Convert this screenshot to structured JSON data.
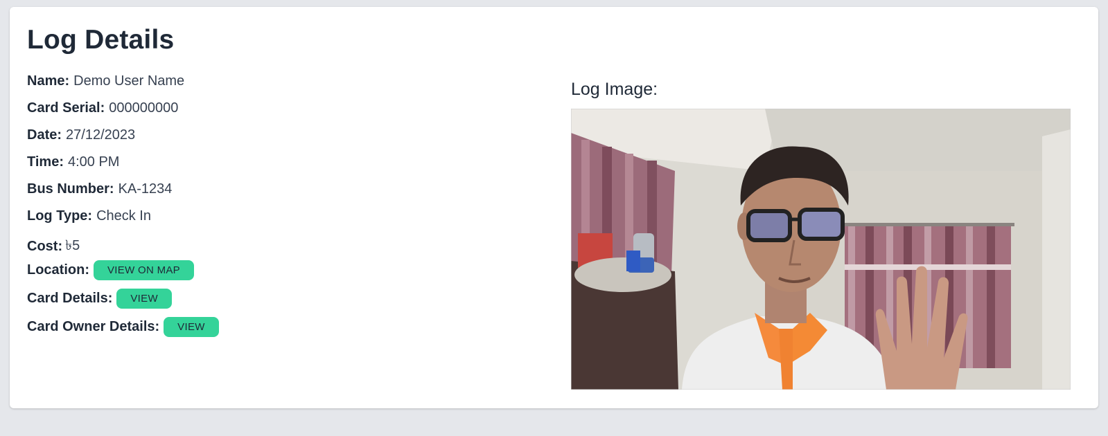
{
  "page": {
    "title": "Log Details"
  },
  "fields": {
    "name_label": "Name:",
    "name_value": "Demo User Name",
    "serial_label": "Card Serial:",
    "serial_value": "000000000",
    "date_label": "Date:",
    "date_value": "27/12/2023",
    "time_label": "Time:",
    "time_value": "4:00 PM",
    "bus_label": "Bus Number:",
    "bus_value": "KA-1234",
    "logtype_label": "Log Type:",
    "logtype_value": "Check In",
    "cost_label": "Cost:",
    "cost_value": "৳5",
    "location_label": "Location:",
    "location_button": "VIEW ON MAP",
    "card_details_label": "Card Details:",
    "card_details_button": "VIEW",
    "owner_details_label": "Card Owner Details:",
    "owner_details_button": "VIEW"
  },
  "image_panel": {
    "title": "Log Image:",
    "image_alt": "log-photo"
  },
  "colors": {
    "button_bg": "#34d399",
    "page_bg": "#e5e7eb",
    "card_bg": "#ffffff",
    "text": "#1f2937"
  }
}
